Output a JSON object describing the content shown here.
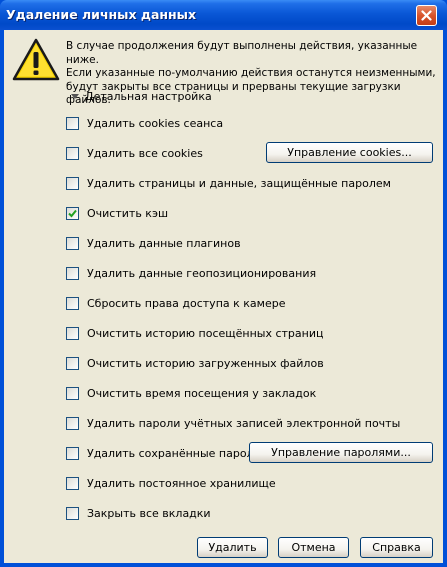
{
  "window": {
    "title": "Удаление личных данных"
  },
  "message": {
    "line1": "В случае продолжения будут выполнены действия, указанные ниже.",
    "line2": "Если указанные по-умолчанию действия останутся неизменными,",
    "line3": "будут закрыты все страницы и прерваны текущие загрузки файлов."
  },
  "detail_settings": {
    "label": "Детальная настройка"
  },
  "options": [
    {
      "label": "Удалить cookies сеанса",
      "checked": false
    },
    {
      "label": "Удалить все cookies",
      "checked": false
    },
    {
      "label": "Удалить страницы и данные, защищённые паролем",
      "checked": false
    },
    {
      "label": "Очистить кэш",
      "checked": true
    },
    {
      "label": "Удалить данные плагинов",
      "checked": false
    },
    {
      "label": "Удалить данные геопозиционирования",
      "checked": false
    },
    {
      "label": "Сбросить права доступа к камере",
      "checked": false
    },
    {
      "label": "Очистить историю посещённых страниц",
      "checked": false
    },
    {
      "label": "Очистить историю загруженных файлов",
      "checked": false
    },
    {
      "label": "Очистить время посещения у закладок",
      "checked": false
    },
    {
      "label": "Удалить пароли учётных записей электронной почты",
      "checked": false
    },
    {
      "label": "Удалить сохранённые пароли",
      "checked": false
    },
    {
      "label": "Удалить постоянное хранилище",
      "checked": false
    },
    {
      "label": "Закрыть все вкладки",
      "checked": false
    }
  ],
  "buttons": {
    "manage_cookies": "Управление cookies...",
    "manage_passwords": "Управление паролями...",
    "delete": "Удалить",
    "cancel": "Отмена",
    "help": "Справка"
  },
  "icons": {
    "warning": "warning-icon",
    "close": "close-icon",
    "checkmark": "checkmark-icon",
    "expand": "triangle-down-icon"
  },
  "colors": {
    "titlebar": "#0a57d6",
    "dialog_bg": "#ece9d8",
    "close_button": "#d9542c",
    "warning_yellow": "#f5d200",
    "checkmark": "#21a121"
  }
}
